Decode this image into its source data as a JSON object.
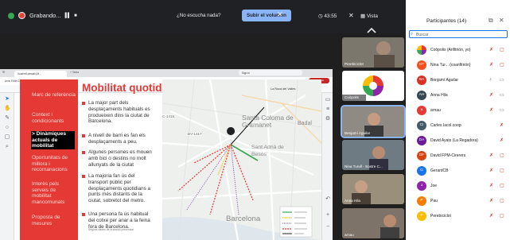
{
  "topbar": {
    "recording_label": "Grabando...",
    "noise_prompt": "¿No escucha nada?",
    "volume_button": "Subir el volumen",
    "clock": "43:55",
    "view_label": "Vista"
  },
  "browser": {
    "tab_title": "Voorhelt pmsalii (M... ",
    "new_tab": "+ Tabla",
    "menu": "Arxiu  Edita  Convert  Edició",
    "address": "Sign in",
    "profile_button": "En aturar",
    "toolbar": "Finalitzat a: finals   Q"
  },
  "slide": {
    "title": "Mobilitat quotidiana",
    "side_items": [
      "Marc de referència",
      "Context i condicionants",
      "> Dinàmiques actuals de mobilitat",
      "Oportunitats de millora i recomanacions",
      "Interès pels serveis de mobilitat mancomunats",
      "Proposta de mesures"
    ],
    "bullets": [
      "La major part dels desplaçaments habituals es produeixen dins la ciutat de Barcelona.",
      "A nivell de barri es fan els desplaçaments a peu.",
      "Algunes persones es mouen amb bici o destins no molt allunyats de la ciutat",
      "La majoria fan ús del transport públic per desplaçaments quotidians a punts més distants de la ciutat, sobretot del metro.",
      "Una persona fa ús habitual del cotxe per anar a la feina fora de Barcelona."
    ],
    "footnote": "Segons dades de la sessió presencial",
    "map_labels": {
      "roca": "La Roca del Vallès",
      "santa_coloma": "Santa Coloma de Gramanet",
      "badal": "Badal",
      "sant_adria": "Sant Adrià de Besòs",
      "barcelona": "Barcelona",
      "road1": "C-1415",
      "road2": "BV-1417"
    }
  },
  "tiles": [
    {
      "name": "Perebiciclot"
    },
    {
      "name": "Coòpolis"
    },
    {
      "name": "Benjamí Aguilar"
    },
    {
      "name": "Nina Turull - Sostre C..."
    },
    {
      "name": "Anna Hila"
    },
    {
      "name": "arnau"
    }
  ],
  "panel": {
    "title": "Participantes (14)",
    "search_placeholder": "Buscar",
    "participants": [
      {
        "initials": "C",
        "name": "Coòpolis (Anfitrión, yo)",
        "color": "#e65100"
      },
      {
        "initials": "NT",
        "name": "Nina Tur... (coanfitrión)",
        "color": "#f4511e"
      },
      {
        "initials": "BA",
        "name": "Benjamí Aguilar",
        "color": "#d93025"
      },
      {
        "initials": "AH",
        "name": "Anna Hila",
        "color": "#37474f"
      },
      {
        "initials": "a",
        "name": "arnau",
        "color": "#e53935"
      },
      {
        "initials": "CI",
        "name": "Carles Iacol.coop",
        "color": "#455a64"
      },
      {
        "initials": "DA",
        "name": "David Ayats (La Regadora)",
        "color": "#6a1b9a"
      },
      {
        "initials": "DF",
        "name": "David FPM-Cirerers",
        "color": "#d84315"
      },
      {
        "initials": "G",
        "name": "GerardCB",
        "color": "#1a73e8"
      },
      {
        "initials": "J",
        "name": "Joe",
        "color": "#8e24aa"
      },
      {
        "initials": "P",
        "name": "Pau",
        "color": "#f57c00"
      },
      {
        "initials": "P",
        "name": "Perebiciclot",
        "color": "#fbbc04"
      }
    ]
  }
}
